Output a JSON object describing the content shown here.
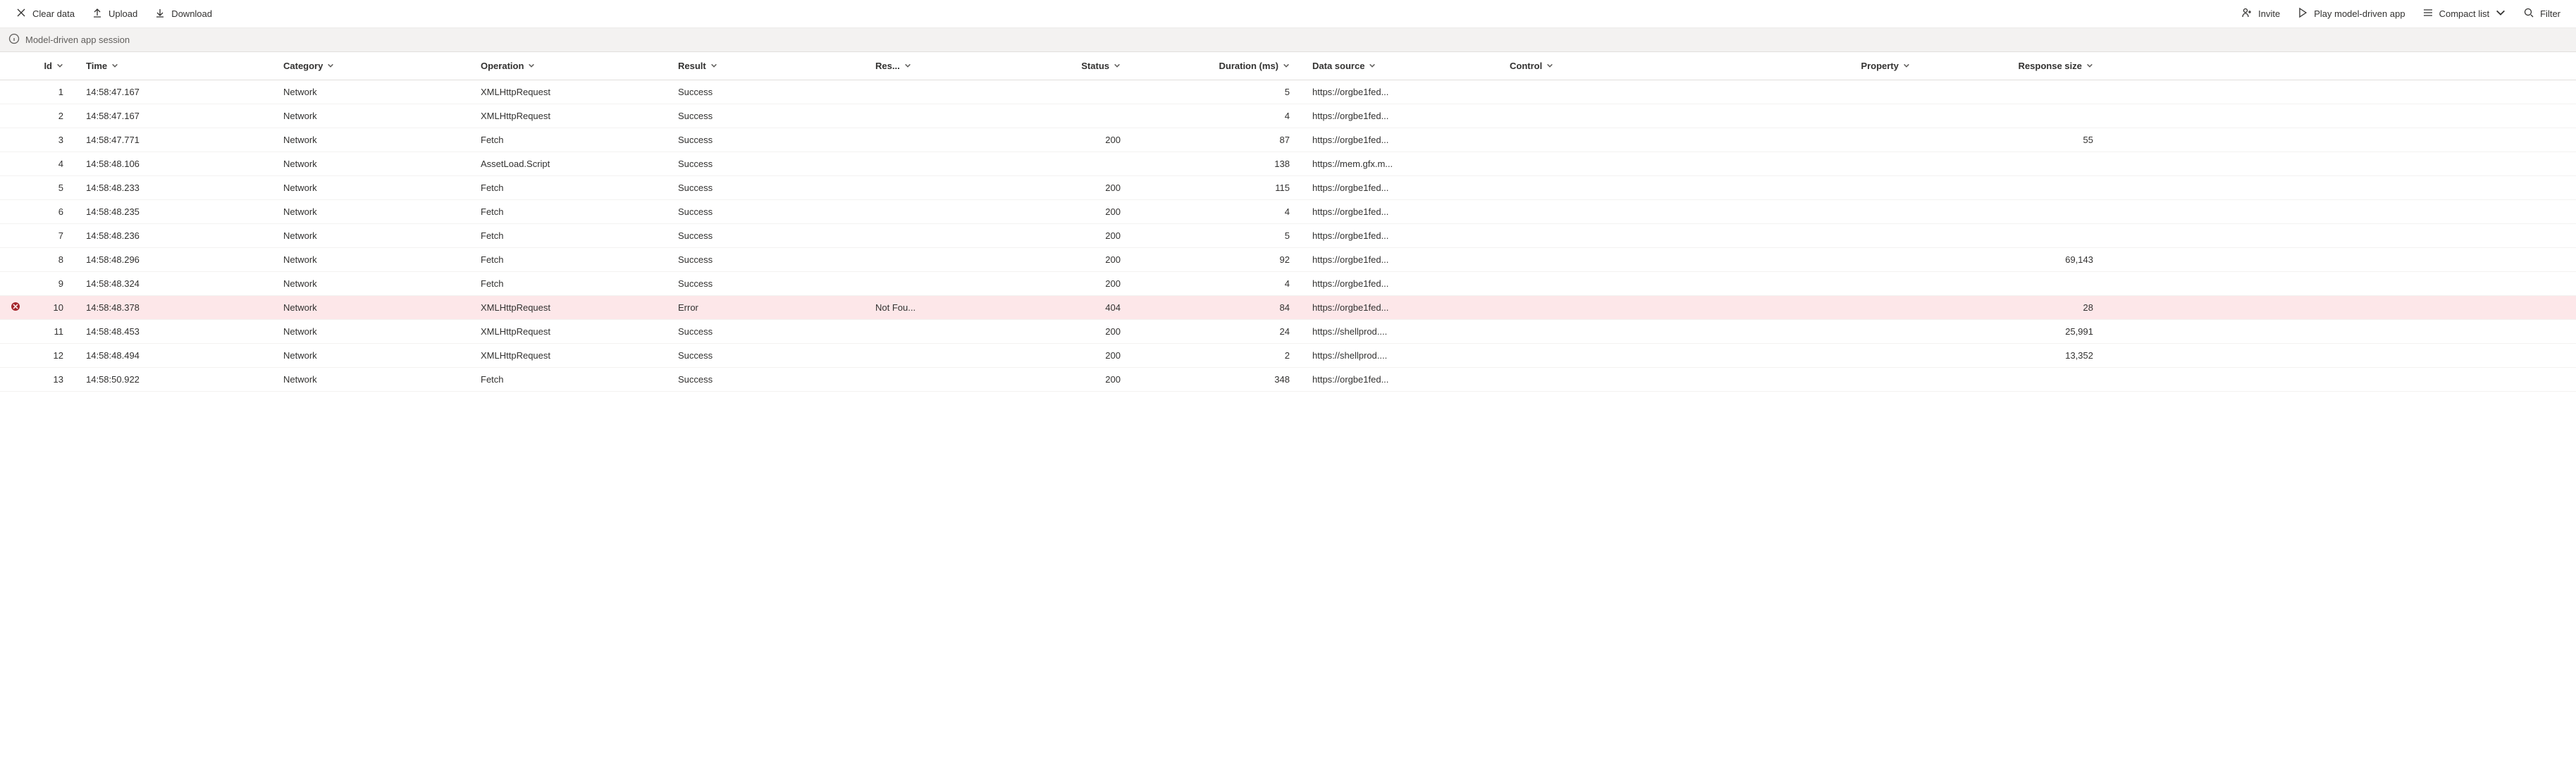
{
  "toolbar": {
    "clear": "Clear data",
    "upload": "Upload",
    "download": "Download",
    "invite": "Invite",
    "play": "Play model-driven app",
    "compact": "Compact list",
    "filter": "Filter"
  },
  "infobar": {
    "title": "Model-driven app session"
  },
  "columns": {
    "id": "Id",
    "time": "Time",
    "category": "Category",
    "operation": "Operation",
    "result": "Result",
    "resshort": "Res...",
    "status": "Status",
    "duration": "Duration (ms)",
    "datasource": "Data source",
    "control": "Control",
    "property": "Property",
    "respsize": "Response size"
  },
  "rows": [
    {
      "id": "1",
      "time": "14:58:47.167",
      "category": "Network",
      "operation": "XMLHttpRequest",
      "result": "Success",
      "resshort": "",
      "status": "",
      "duration": "5",
      "datasource": "https://orgbe1fed...",
      "control": "",
      "property": "",
      "respsize": "",
      "error": false
    },
    {
      "id": "2",
      "time": "14:58:47.167",
      "category": "Network",
      "operation": "XMLHttpRequest",
      "result": "Success",
      "resshort": "",
      "status": "",
      "duration": "4",
      "datasource": "https://orgbe1fed...",
      "control": "",
      "property": "",
      "respsize": "",
      "error": false
    },
    {
      "id": "3",
      "time": "14:58:47.771",
      "category": "Network",
      "operation": "Fetch",
      "result": "Success",
      "resshort": "",
      "status": "200",
      "duration": "87",
      "datasource": "https://orgbe1fed...",
      "control": "",
      "property": "",
      "respsize": "55",
      "error": false
    },
    {
      "id": "4",
      "time": "14:58:48.106",
      "category": "Network",
      "operation": "AssetLoad.Script",
      "result": "Success",
      "resshort": "",
      "status": "",
      "duration": "138",
      "datasource": "https://mem.gfx.m...",
      "control": "",
      "property": "",
      "respsize": "",
      "error": false
    },
    {
      "id": "5",
      "time": "14:58:48.233",
      "category": "Network",
      "operation": "Fetch",
      "result": "Success",
      "resshort": "",
      "status": "200",
      "duration": "115",
      "datasource": "https://orgbe1fed...",
      "control": "",
      "property": "",
      "respsize": "",
      "error": false
    },
    {
      "id": "6",
      "time": "14:58:48.235",
      "category": "Network",
      "operation": "Fetch",
      "result": "Success",
      "resshort": "",
      "status": "200",
      "duration": "4",
      "datasource": "https://orgbe1fed...",
      "control": "",
      "property": "",
      "respsize": "",
      "error": false
    },
    {
      "id": "7",
      "time": "14:58:48.236",
      "category": "Network",
      "operation": "Fetch",
      "result": "Success",
      "resshort": "",
      "status": "200",
      "duration": "5",
      "datasource": "https://orgbe1fed...",
      "control": "",
      "property": "",
      "respsize": "",
      "error": false
    },
    {
      "id": "8",
      "time": "14:58:48.296",
      "category": "Network",
      "operation": "Fetch",
      "result": "Success",
      "resshort": "",
      "status": "200",
      "duration": "92",
      "datasource": "https://orgbe1fed...",
      "control": "",
      "property": "",
      "respsize": "69,143",
      "error": false
    },
    {
      "id": "9",
      "time": "14:58:48.324",
      "category": "Network",
      "operation": "Fetch",
      "result": "Success",
      "resshort": "",
      "status": "200",
      "duration": "4",
      "datasource": "https://orgbe1fed...",
      "control": "",
      "property": "",
      "respsize": "",
      "error": false
    },
    {
      "id": "10",
      "time": "14:58:48.378",
      "category": "Network",
      "operation": "XMLHttpRequest",
      "result": "Error",
      "resshort": "Not Fou...",
      "status": "404",
      "duration": "84",
      "datasource": "https://orgbe1fed...",
      "control": "",
      "property": "",
      "respsize": "28",
      "error": true
    },
    {
      "id": "11",
      "time": "14:58:48.453",
      "category": "Network",
      "operation": "XMLHttpRequest",
      "result": "Success",
      "resshort": "",
      "status": "200",
      "duration": "24",
      "datasource": "https://shellprod....",
      "control": "",
      "property": "",
      "respsize": "25,991",
      "error": false
    },
    {
      "id": "12",
      "time": "14:58:48.494",
      "category": "Network",
      "operation": "XMLHttpRequest",
      "result": "Success",
      "resshort": "",
      "status": "200",
      "duration": "2",
      "datasource": "https://shellprod....",
      "control": "",
      "property": "",
      "respsize": "13,352",
      "error": false
    },
    {
      "id": "13",
      "time": "14:58:50.922",
      "category": "Network",
      "operation": "Fetch",
      "result": "Success",
      "resshort": "",
      "status": "200",
      "duration": "348",
      "datasource": "https://orgbe1fed...",
      "control": "",
      "property": "",
      "respsize": "",
      "error": false
    }
  ]
}
